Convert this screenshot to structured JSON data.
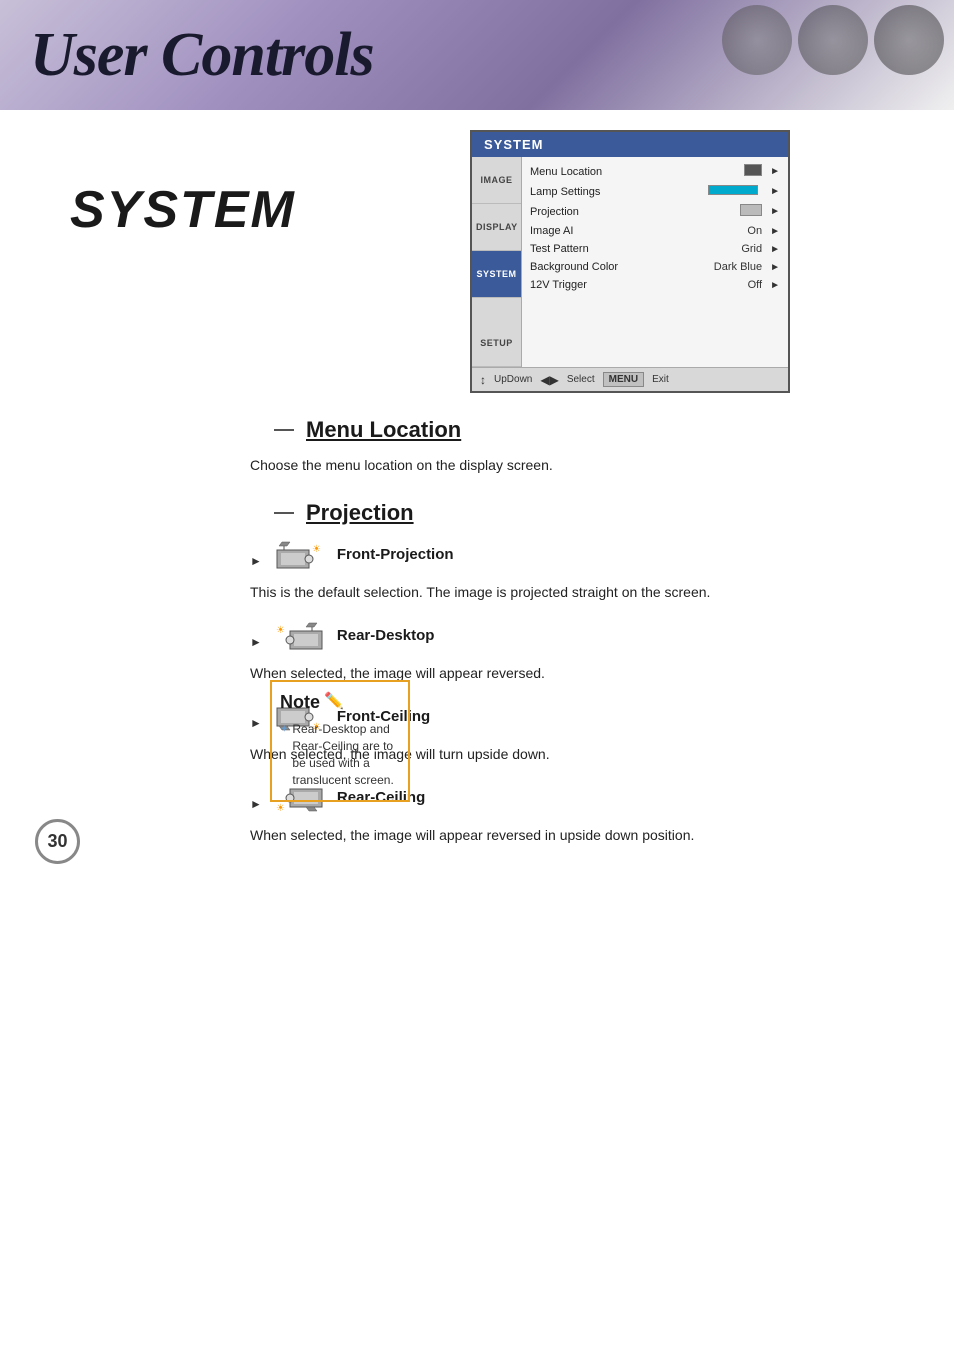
{
  "header": {
    "title": "User Controls"
  },
  "osd": {
    "title": "SYSTEM",
    "nav_items": [
      {
        "label": "IMAGE",
        "active": false
      },
      {
        "label": "DISPLAY",
        "active": false
      },
      {
        "label": "SYSTEM",
        "active": true
      },
      {
        "label": "SETUP",
        "active": false
      }
    ],
    "menu_rows": [
      {
        "label": "Menu Location",
        "value": "",
        "value_type": "color_box",
        "has_arrow": true
      },
      {
        "label": "Lamp Settings",
        "value": "",
        "value_type": "cyan_bar",
        "has_arrow": true,
        "highlighted": false
      },
      {
        "label": "Projection",
        "value": "",
        "value_type": "proj_icon",
        "has_arrow": true,
        "highlighted": false
      },
      {
        "label": "Image AI",
        "value": "On",
        "has_arrow": true
      },
      {
        "label": "Test Pattern",
        "value": "Grid",
        "has_arrow": true
      },
      {
        "label": "Background Color",
        "value": "Dark Blue",
        "has_arrow": true
      },
      {
        "label": "12V Trigger",
        "value": "Off",
        "has_arrow": true
      }
    ],
    "footer": {
      "updown_label": "UpDown",
      "select_label": "Select",
      "menu_label": "MENU",
      "exit_label": "Exit"
    }
  },
  "sections": {
    "menu_location": {
      "heading": "Menu Location",
      "desc": "Choose the menu location on the display screen."
    },
    "projection": {
      "heading": "Projection",
      "options": [
        {
          "label": "Front-Projection",
          "desc": "This is the default selection. The image is projected straight on the screen.",
          "icon_type": "front-projection"
        },
        {
          "label": "Rear-Desktop",
          "desc": "When selected, the image will appear reversed.",
          "icon_type": "rear-desktop"
        },
        {
          "label": "Front-Ceiling",
          "desc": "When selected, the image will turn upside down.",
          "icon_type": "front-ceiling"
        },
        {
          "label": "Rear-Ceiling",
          "desc": "When selected, the image will appear reversed in upside down position.",
          "icon_type": "rear-ceiling"
        }
      ]
    }
  },
  "note": {
    "title": "Note",
    "items": [
      "Rear-Desktop and Rear-Ceiling are to be used with a translucent screen."
    ]
  },
  "page_number": "30"
}
